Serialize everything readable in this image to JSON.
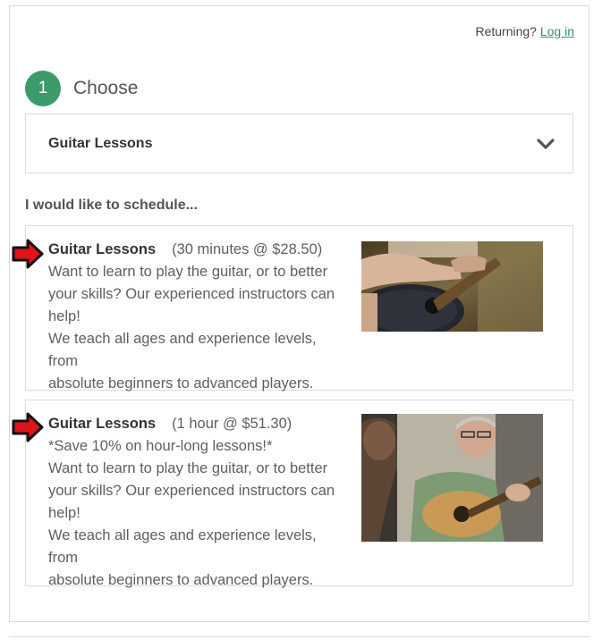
{
  "header": {
    "returning_text": "Returning?",
    "login_label": "Log in"
  },
  "step": {
    "number": "1",
    "title": "Choose"
  },
  "category_select": {
    "selected": "Guitar Lessons",
    "icon": "chevron-down-icon"
  },
  "schedule_label": "I would like to schedule...",
  "options": [
    {
      "name": "Guitar Lessons",
      "price": "(30 minutes @ $28.50)",
      "lines": [
        "Want to learn to play the guitar, or to better",
        "your skills? Our experienced instructors can",
        "help!",
        "We teach all ages and experience levels, from",
        "absolute beginners to advanced players."
      ]
    },
    {
      "name": "Guitar Lessons",
      "price": "(1 hour @ $51.30)",
      "lines": [
        "*Save 10% on hour-long lessons!*",
        "Want to learn to play the guitar, or to better",
        "your skills? Our experienced instructors can",
        "help!",
        "We teach all ages and experience levels, from",
        "absolute beginners to advanced players."
      ]
    }
  ],
  "colors": {
    "accent_green": "#3d9a6b",
    "link_green": "#3a8e63",
    "arrow_red": "#e0121a"
  }
}
